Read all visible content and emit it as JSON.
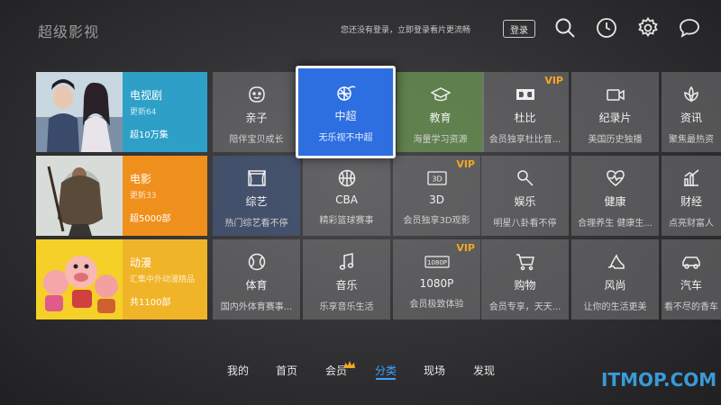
{
  "app": {
    "title": "超级影视"
  },
  "header": {
    "login_prompt": "您还没有登录，立即登录看片更流畅",
    "login_button": "登录",
    "icons": [
      "search-icon",
      "history-clock-icon",
      "settings-gear-icon",
      "message-bubble-icon"
    ]
  },
  "features": [
    {
      "title": "电视剧",
      "subtitle": "更新64",
      "count": "超10万集",
      "color": "#2ea0c8"
    },
    {
      "title": "电影",
      "subtitle": "更新33",
      "count": "超5000部",
      "color": "#f0901c"
    },
    {
      "title": "动漫",
      "subtitle": "汇集中外动漫精品",
      "count": "共1100部",
      "color": "#f0b428"
    }
  ],
  "rows": [
    [
      {
        "title": "亲子",
        "subtitle": "陪伴宝贝成长",
        "icon": "baby-face-icon"
      },
      {
        "title": "中超",
        "subtitle": "无乐视不中超",
        "icon": "soccer-ball-icon",
        "focused": true
      },
      {
        "title": "教育",
        "subtitle": "海量学习资源",
        "icon": "graduation-cap-icon"
      },
      {
        "title": "杜比",
        "subtitle": "会员独享杜比音...",
        "icon": "dolby-icon",
        "vip": "VIP"
      },
      {
        "title": "纪录片",
        "subtitle": "美国历史独播",
        "icon": "video-camera-icon"
      },
      {
        "title": "资讯",
        "subtitle": "聚焦最热资",
        "icon": "lotus-icon"
      }
    ],
    [
      {
        "title": "综艺",
        "subtitle": "热门综艺看不停",
        "icon": "stage-curtain-icon"
      },
      {
        "title": "CBA",
        "subtitle": "精彩篮球赛事",
        "icon": "basketball-icon"
      },
      {
        "title": "3D",
        "subtitle": "会员独享3D观影",
        "icon": "3d-icon",
        "vip": "VIP"
      },
      {
        "title": "娱乐",
        "subtitle": "明星八卦看不停",
        "icon": "microphone-icon"
      },
      {
        "title": "健康",
        "subtitle": "合理养生 健康生...",
        "icon": "heart-pulse-icon"
      },
      {
        "title": "财经",
        "subtitle": "点亮财富人",
        "icon": "bar-chart-icon"
      }
    ],
    [
      {
        "title": "体育",
        "subtitle": "国内外体育赛事...",
        "icon": "sports-ball-icon"
      },
      {
        "title": "音乐",
        "subtitle": "乐享音乐生活",
        "icon": "music-note-icon"
      },
      {
        "title": "1080P",
        "subtitle": "会员极致体验",
        "icon": "1080p-icon",
        "vip": "VIP",
        "badge": "1080P"
      },
      {
        "title": "购物",
        "subtitle": "会员专享，天天...",
        "icon": "shopping-cart-icon"
      },
      {
        "title": "风尚",
        "subtitle": "让你的生活更美",
        "icon": "high-heel-icon"
      },
      {
        "title": "汽车",
        "subtitle": "看不尽的香车",
        "icon": "car-icon"
      }
    ]
  ],
  "nav": {
    "items": [
      "我的",
      "首页",
      "会员",
      "分类",
      "现场",
      "发现"
    ],
    "active": "分类"
  },
  "watermark": "ITMOP.COM"
}
